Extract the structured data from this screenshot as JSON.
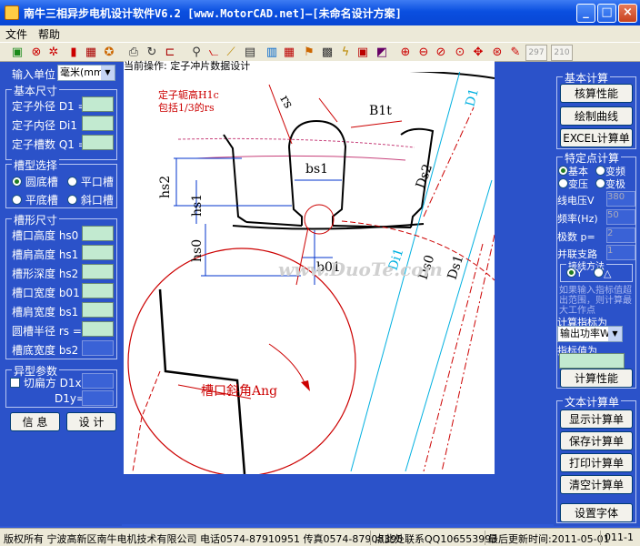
{
  "window": {
    "title": "南牛三相异步电机设计软件V6.2  [www.MotorCAD.net]—[未命名设计方案]"
  },
  "menu": [
    "文件",
    "帮助"
  ],
  "toolbar": {
    "box1": "297",
    "box2": "210"
  },
  "left": {
    "unit_label": "输入单位",
    "unit_value": "毫米(mm)",
    "basic_title": "基本尺寸",
    "basic": [
      "定子外径 D1 =",
      "定子内径 Di1 =",
      "定子槽数 Q1 ="
    ],
    "slot_select_title": "槽型选择",
    "slot_options": [
      "圆底槽",
      "平口槽",
      "平底槽",
      "斜口槽"
    ],
    "slot_dims_title": "槽形尺寸",
    "slot_dims": [
      "槽口高度 hs0 =",
      "槽肩高度 hs1 =",
      "槽形深度 hs2 =",
      "槽口宽度 b01 =",
      "槽肩宽度 bs1 =",
      "圆槽半径  rs =",
      "槽底宽度 bs2 ="
    ],
    "special_title": "异型参数",
    "cut_label": "切扁方 D1x=",
    "d1y_label": "D1y=",
    "info_btn": "信  息",
    "design_btn": "设  计"
  },
  "canvas": {
    "operation": "当前操作: 定子冲片数据设计",
    "note1": "定子轭高H1c",
    "note2": "包括1/3的rs",
    "labels": {
      "rs": "rs",
      "B1t": "B1t",
      "D1": "D1",
      "Ds2": "Ds2",
      "hs2": "hs2",
      "bs1": "bs1",
      "hs1": "hs1",
      "hs0": "hs0",
      "b01": "b01",
      "Di1": "Di1",
      "Ds0": "Ds0",
      "Ds1": "Ds1",
      "angle": "槽口斜角Ang"
    },
    "watermark": "www.DuoTe.com"
  },
  "right": {
    "basic_calc_title": "基本计算",
    "buttons": [
      "核算性能",
      "绘制曲线",
      "EXCEL计算单"
    ],
    "special_title": "特定点计算",
    "modes": [
      "基本",
      "变频",
      "变压",
      "变极"
    ],
    "params": [
      "线电压V",
      "频率(Hz)",
      "极数 p=",
      "并联支路"
    ],
    "param_values": [
      "380",
      "50",
      "2",
      "1"
    ],
    "connection_title": "接线方法",
    "connection": [
      "Y",
      "△"
    ],
    "hint": "如果输入指标值超出范围，则计算最大工作点",
    "indicator_label": "计算指标为",
    "indicator_value": "输出功率W",
    "indicator_value_label": "指标值为",
    "calc_perf_btn": "计算性能",
    "text_calc_title": "文本计算单",
    "text_buttons": [
      "显示计算单",
      "保存计算单",
      "打印计算单",
      "清空计算单",
      "设置字体"
    ]
  },
  "status": {
    "copyright": "版权所有 宁波高新区南牛电机技术有限公司 电话0574-87910951 传真0574-87908395",
    "contact": "点此处联系QQ106553993",
    "updated": "最后更新时间:2011-05-01",
    "page": "011-1"
  }
}
